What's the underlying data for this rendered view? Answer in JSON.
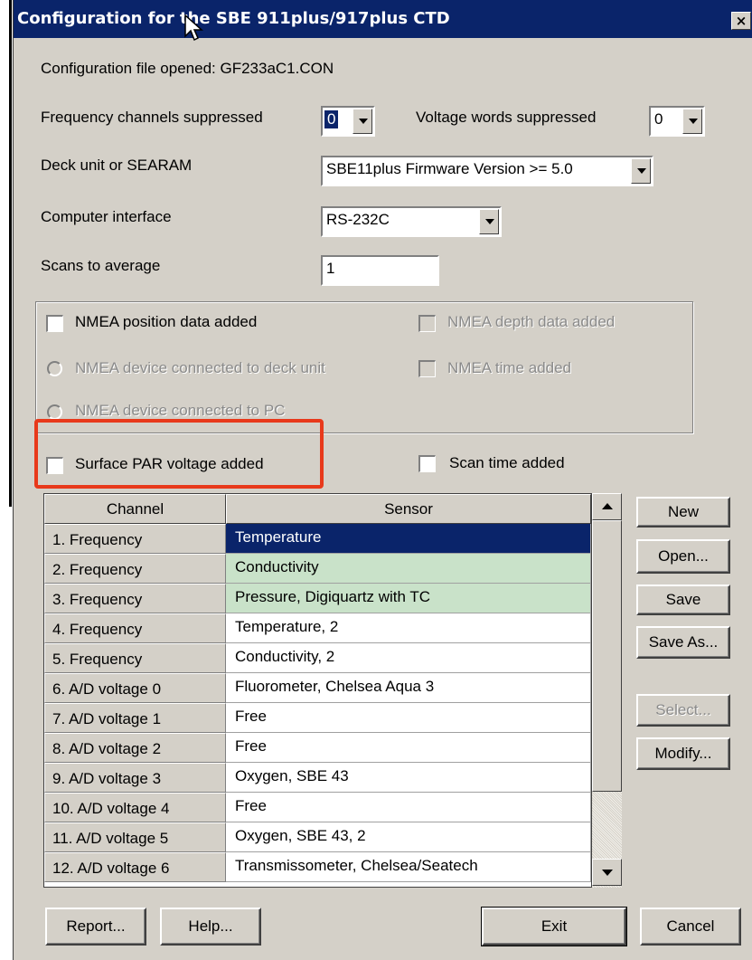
{
  "window": {
    "title": "Configuration for the SBE 911plus/917plus CTD",
    "close_label": "×"
  },
  "config_file": "Configuration file opened: GF233aC1.CON",
  "fields": {
    "freq_suppressed_label": "Frequency channels suppressed",
    "freq_suppressed_value": "0",
    "volt_suppressed_label": "Voltage words suppressed",
    "volt_suppressed_value": "0",
    "deck_unit_label": "Deck unit or SEARAM",
    "deck_unit_value": "SBE11plus Firmware Version >= 5.0",
    "computer_interface_label": "Computer interface",
    "computer_interface_value": "RS-232C",
    "scans_label": "Scans to average",
    "scans_value": "1"
  },
  "nmea": {
    "position_added": "NMEA position data added",
    "depth_added": "NMEA depth data added",
    "device_deck_unit": "NMEA device connected to deck unit",
    "time_added": "NMEA time added",
    "device_pc": "NMEA device connected to PC"
  },
  "options": {
    "surface_par": "Surface PAR voltage added",
    "scan_time": "Scan time added"
  },
  "table": {
    "headers": [
      "Channel",
      "Sensor"
    ],
    "rows": [
      {
        "channel": "1. Frequency",
        "sensor": "Temperature"
      },
      {
        "channel": "2. Frequency",
        "sensor": "Conductivity"
      },
      {
        "channel": "3. Frequency",
        "sensor": "Pressure, Digiquartz with TC"
      },
      {
        "channel": "4. Frequency",
        "sensor": "Temperature, 2"
      },
      {
        "channel": "5. Frequency",
        "sensor": "Conductivity, 2"
      },
      {
        "channel": "6. A/D voltage 0",
        "sensor": "Fluorometer, Chelsea Aqua 3"
      },
      {
        "channel": "7. A/D voltage 1",
        "sensor": "Free"
      },
      {
        "channel": "8. A/D voltage 2",
        "sensor": "Free"
      },
      {
        "channel": "9. A/D voltage 3",
        "sensor": "Oxygen, SBE 43"
      },
      {
        "channel": "10. A/D voltage 4",
        "sensor": "Free"
      },
      {
        "channel": "11. A/D voltage 5",
        "sensor": "Oxygen, SBE 43, 2"
      },
      {
        "channel": "12. A/D voltage 6",
        "sensor": "Transmissometer, Chelsea/Seatech"
      }
    ]
  },
  "buttons": {
    "new": "New",
    "open": "Open...",
    "save": "Save",
    "save_as": "Save As...",
    "select": "Select...",
    "modify": "Modify...",
    "report": "Report...",
    "help": "Help...",
    "exit": "Exit",
    "cancel": "Cancel"
  },
  "colors": {
    "titlebar": "#0a246a",
    "dialog_face": "#d4d0c8",
    "selected_row": "#0a246a",
    "fixed_sensor_rows": "#c9e2c9",
    "highlight_box": "#e8391b"
  }
}
